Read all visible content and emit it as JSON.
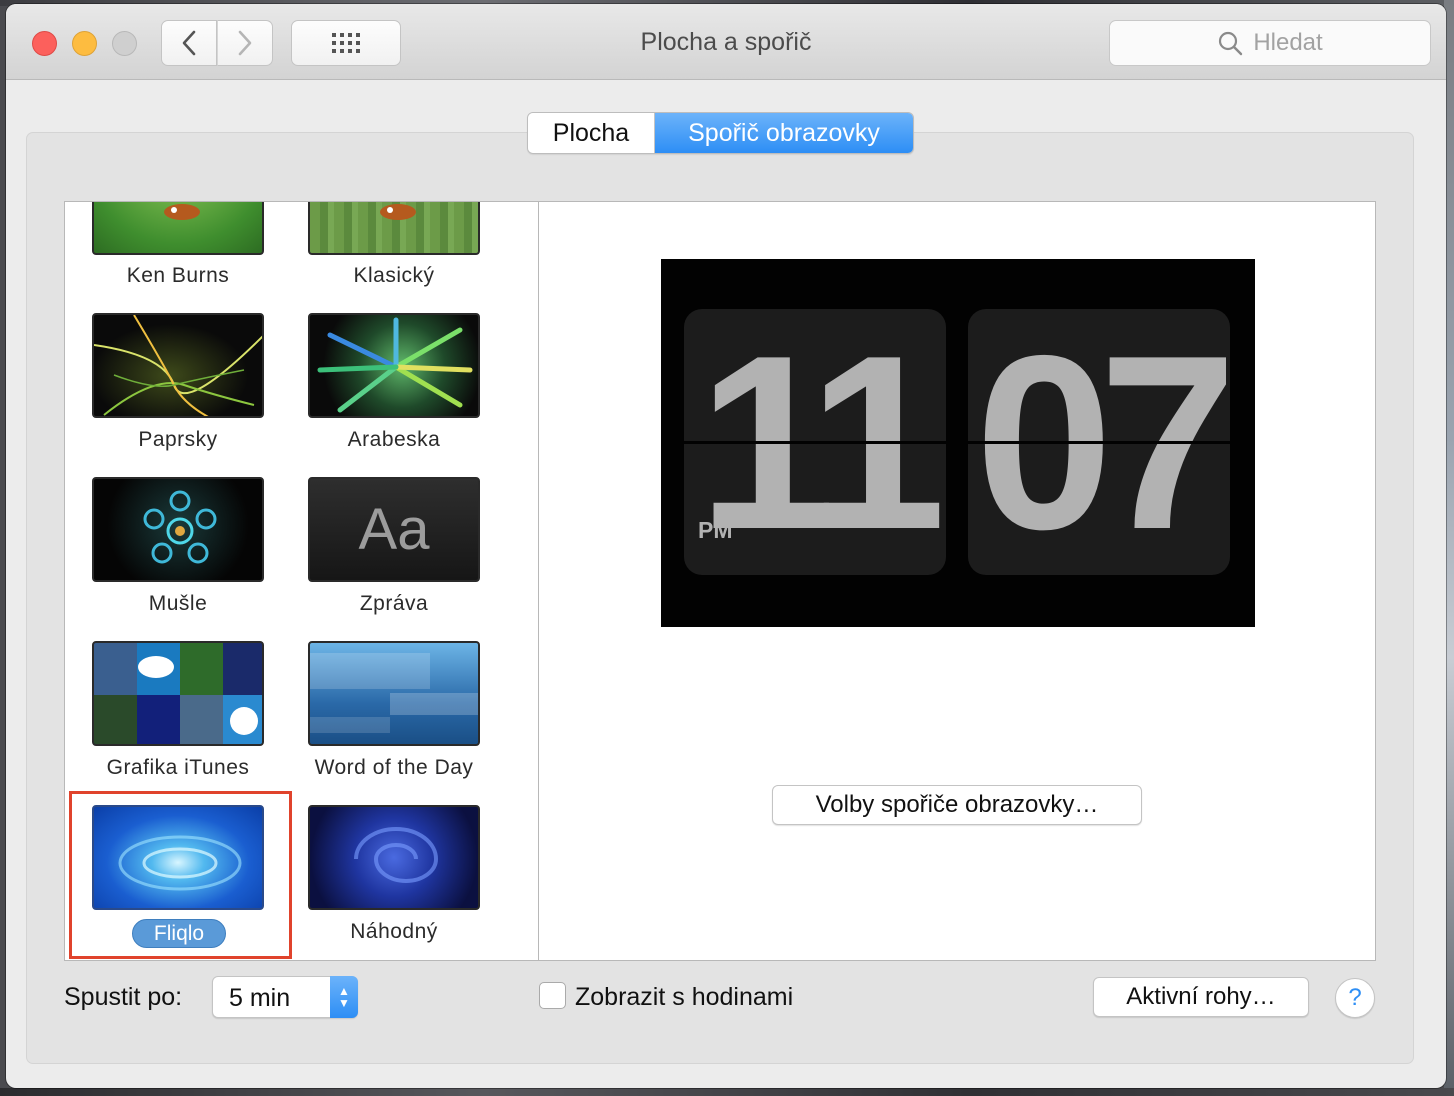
{
  "window": {
    "title": "Plocha a spořič",
    "search_placeholder": "Hledat"
  },
  "tabs": [
    {
      "label": "Plocha",
      "selected": false
    },
    {
      "label": "Spořič obrazovky",
      "selected": true
    }
  ],
  "screensavers": [
    {
      "label": "Ken Burns",
      "icon": "ken-burns-thumbnail"
    },
    {
      "label": "Klasický",
      "icon": "classic-thumbnail"
    },
    {
      "label": "Paprsky",
      "icon": "flurry-thumbnail"
    },
    {
      "label": "Arabeska",
      "icon": "arabesque-thumbnail"
    },
    {
      "label": "Mušle",
      "icon": "shell-thumbnail"
    },
    {
      "label": "Zpráva",
      "icon": "message-thumbnail",
      "thumb_text": "Aa"
    },
    {
      "label": "Grafika iTunes",
      "icon": "itunes-artwork-thumbnail"
    },
    {
      "label": "Word of the Day",
      "icon": "word-of-the-day-thumbnail"
    },
    {
      "label": "Fliqlo",
      "icon": "fliqlo-thumbnail",
      "selected": true
    },
    {
      "label": "Náhodný",
      "icon": "random-thumbnail"
    }
  ],
  "preview": {
    "hours": "11",
    "minutes": "07",
    "ampm": "PM"
  },
  "options_button": "Volby spořiče obrazovky…",
  "start_after": {
    "label": "Spustit po:",
    "value": "5 min"
  },
  "show_clock": {
    "label": "Zobrazit s hodinami",
    "checked": false
  },
  "hot_corners_button": "Aktivní rohy…",
  "help_label": "?",
  "colors": {
    "accent": "#2d8ef5",
    "selection_outline": "#e0432c"
  }
}
